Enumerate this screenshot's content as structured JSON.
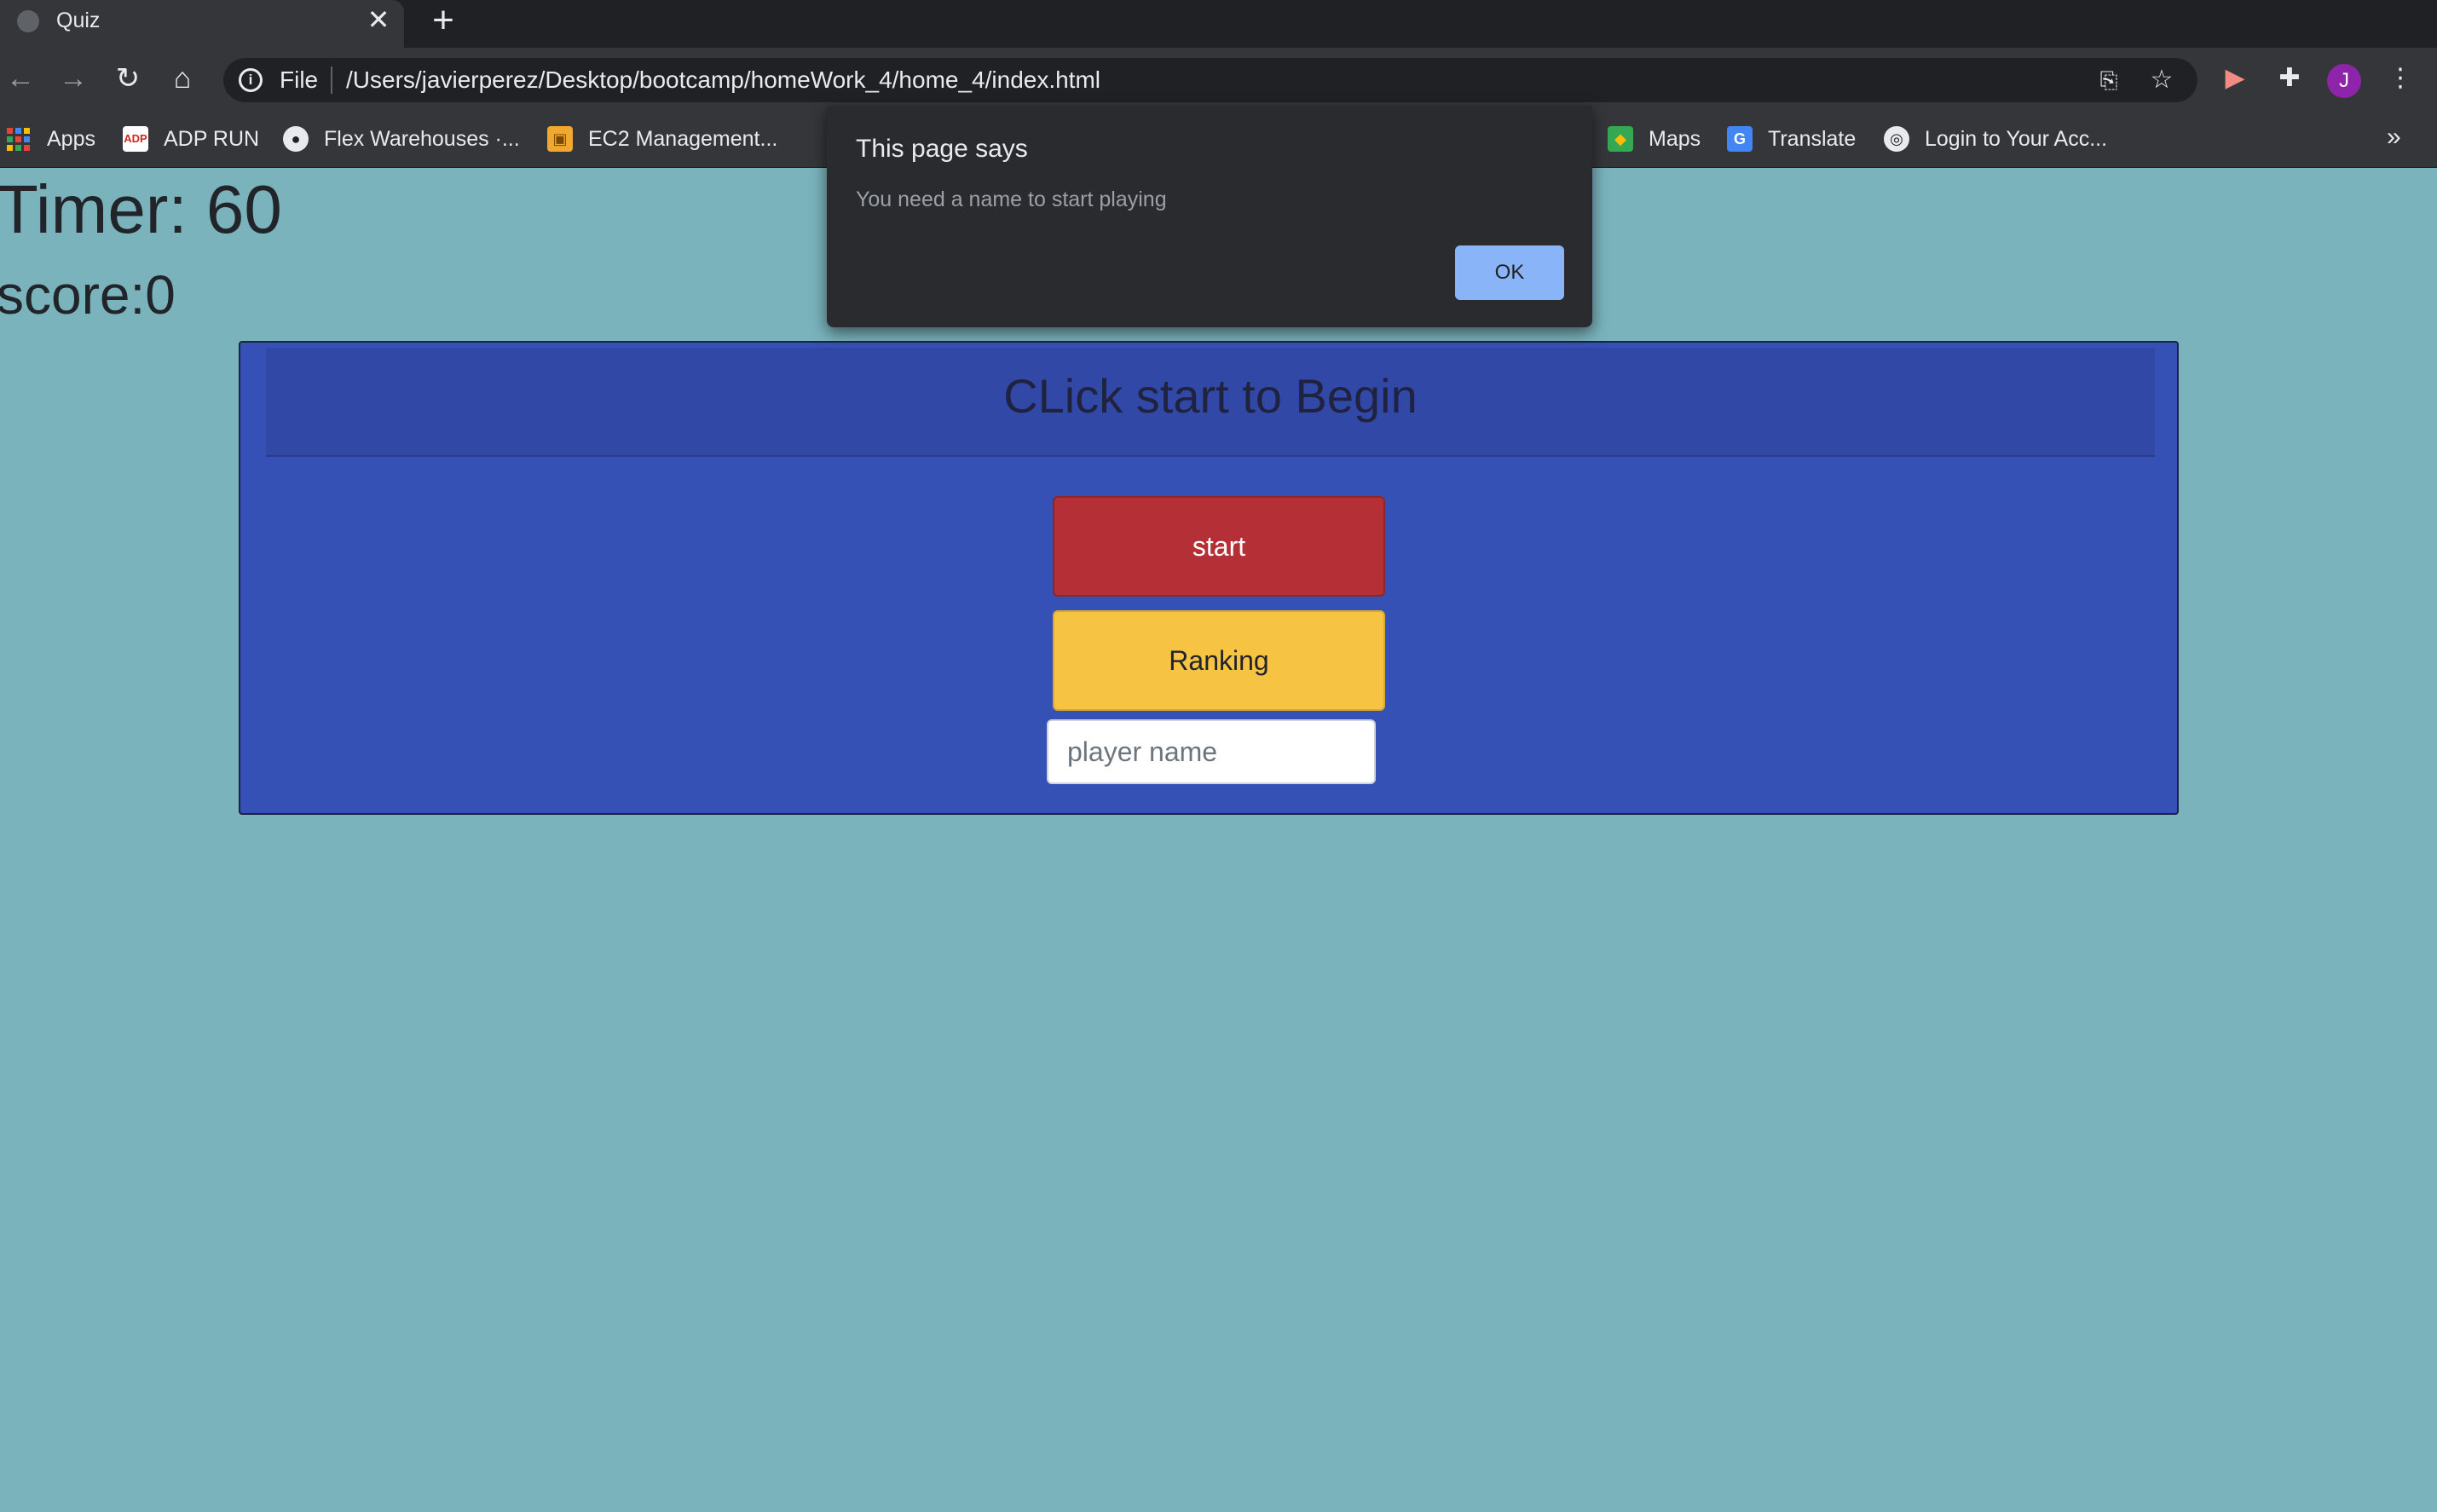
{
  "browser": {
    "tab": {
      "title": "Quiz",
      "close_glyph": "✕"
    },
    "new_tab_glyph": "+",
    "address_bar": {
      "scheme": "File",
      "url": "/Users/javierperez/Desktop/bootcamp/homeWork_4/home_4/index.html"
    },
    "profile_initial": "J",
    "bookmarks": [
      {
        "label": "Apps",
        "icon": "apps-grid-icon"
      },
      {
        "label": "ADP RUN",
        "icon": "adp-icon"
      },
      {
        "label": "Flex Warehouses ·...",
        "icon": "github-icon"
      },
      {
        "label": "EC2 Management...",
        "icon": "aws-box-icon"
      },
      {
        "label": "Maps",
        "icon": "maps-icon"
      },
      {
        "label": "Translate",
        "icon": "translate-icon"
      },
      {
        "label": "Login to Your Acc...",
        "icon": "globe-icon"
      }
    ],
    "bookmarks_overflow": "»"
  },
  "page": {
    "timer_text": "Timer: 60",
    "score_text": "score:0",
    "card_title": "CLick start to Begin",
    "start_label": "start",
    "ranking_label": "Ranking",
    "player_input": {
      "placeholder": "player name",
      "value": ""
    }
  },
  "dialog": {
    "title": "This page says",
    "message": "You need a name to start playing",
    "ok_label": "OK"
  },
  "colors": {
    "page_background": "#7ab3bc",
    "card_background": "#3651b5",
    "start_button": "#b53036",
    "ranking_button": "#f6c343",
    "dialog_ok": "#8ab4f8"
  }
}
